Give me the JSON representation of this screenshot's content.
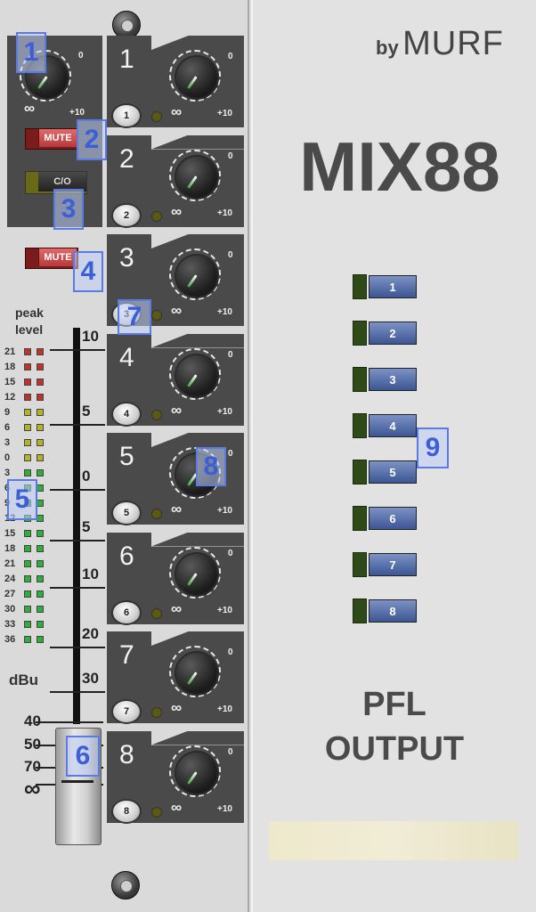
{
  "brand": {
    "by": "by",
    "name": "MURF"
  },
  "title": "MIX88",
  "footer": {
    "line1": "PFL",
    "line2": "OUTPUT"
  },
  "strip": {
    "mute_label": "MUTE",
    "co_label": "C/O",
    "meter_label_1": "peak",
    "meter_label_2": "level",
    "meter_unit": "dBu",
    "meter_scale": [
      "21",
      "18",
      "15",
      "12",
      "9",
      "6",
      "3",
      "0",
      "3",
      "6",
      "9",
      "12",
      "15",
      "18",
      "21",
      "24",
      "27",
      "30",
      "33",
      "36"
    ],
    "fader_scale_right": [
      "10",
      "5",
      "0",
      "5",
      "10",
      "20",
      "30"
    ],
    "fader_scale_left": [
      "40",
      "50",
      "70",
      "∞"
    ]
  },
  "master_knob": {
    "min": "∞",
    "max": "+10",
    "top": "0"
  },
  "channels": [
    {
      "number": "1",
      "button": "1",
      "knob_min": "∞",
      "knob_max": "+10",
      "knob_top": "0"
    },
    {
      "number": "2",
      "button": "2",
      "knob_min": "∞",
      "knob_max": "+10",
      "knob_top": "0"
    },
    {
      "number": "3",
      "button": "3",
      "knob_min": "∞",
      "knob_max": "+10",
      "knob_top": "0"
    },
    {
      "number": "4",
      "button": "4",
      "knob_min": "∞",
      "knob_max": "+10",
      "knob_top": "0"
    },
    {
      "number": "5",
      "button": "5",
      "knob_min": "∞",
      "knob_max": "+10",
      "knob_top": "0"
    },
    {
      "number": "6",
      "button": "6",
      "knob_min": "∞",
      "knob_max": "+10",
      "knob_top": "0"
    },
    {
      "number": "7",
      "button": "7",
      "knob_min": "∞",
      "knob_max": "+10",
      "knob_top": "0"
    },
    {
      "number": "8",
      "button": "8",
      "knob_min": "∞",
      "knob_max": "+10",
      "knob_top": "0"
    }
  ],
  "pfl_buttons": [
    "1",
    "2",
    "3",
    "4",
    "5",
    "6",
    "7",
    "8"
  ],
  "annotations": [
    "1",
    "2",
    "3",
    "4",
    "5",
    "6",
    "7",
    "8",
    "9"
  ],
  "colors": {
    "led_red": "#c0322c",
    "led_yellow": "#b4b228",
    "led_green": "#2fae3c",
    "pfl_button": "#4a64a4"
  }
}
